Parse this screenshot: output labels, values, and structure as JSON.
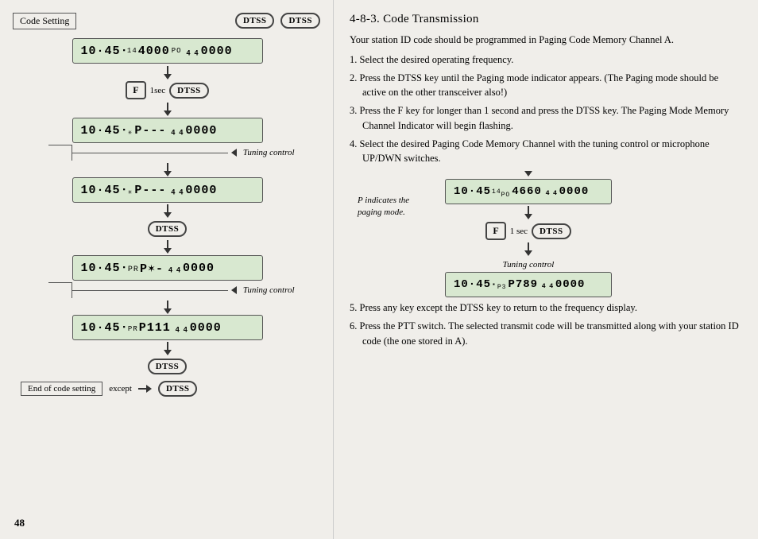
{
  "left": {
    "code_setting_label": "Code Setting",
    "dtss": "DTSS",
    "f_btn": "F",
    "one_sec": "1sec",
    "tuning_control1": "Tuning control",
    "tuning_control2": "Tuning control",
    "end_label": "End of code setting",
    "except_label": "except",
    "displays": {
      "d1": "10·45  ¹⁴4000  ₄₄0000",
      "d2": "10·45   P---  ₄₄0000",
      "d3": "10·45   P---  ₄₄0000",
      "d4": "10·45   P✶-  ₄₄0000",
      "d5": "10·45   P111  ₄₄0000"
    }
  },
  "right": {
    "title": "4-8-3.    Code Transmission",
    "intro": "Your station ID code should be programmed in Paging Code Memory Channel A.",
    "steps": [
      "1.  Select the desired operating frequency.",
      "2.  Press the DTSS key until the Paging mode indicator appears. (The Paging mode should be active on the other transceiver also!)",
      "3.  Press the F key for longer than 1 second and press the DTSS key. The Paging Mode Memory Channel Indicator  will begin flashing.",
      "4.  Select  the desired Paging Code Memory Channel with the tuning control or microphone UP/DWN switches.",
      "5.  Press any key except the DTSS key to return to the frequency display.",
      "6.  Press the PTT switch. The selected transmit code will be transmitted along with your station ID code (the one stored in A)."
    ],
    "p_indicates": "P indicates the\npaging mode.",
    "tuning_control": "Tuning  control",
    "one_sec": "1 sec",
    "dtss": "DTSS",
    "f_btn": "F",
    "displays": {
      "d1": "10·45  ¹⁴4660  ₄₄0000",
      "d2": "10·45   P789  ₄₄0000"
    }
  },
  "page_number": "48"
}
